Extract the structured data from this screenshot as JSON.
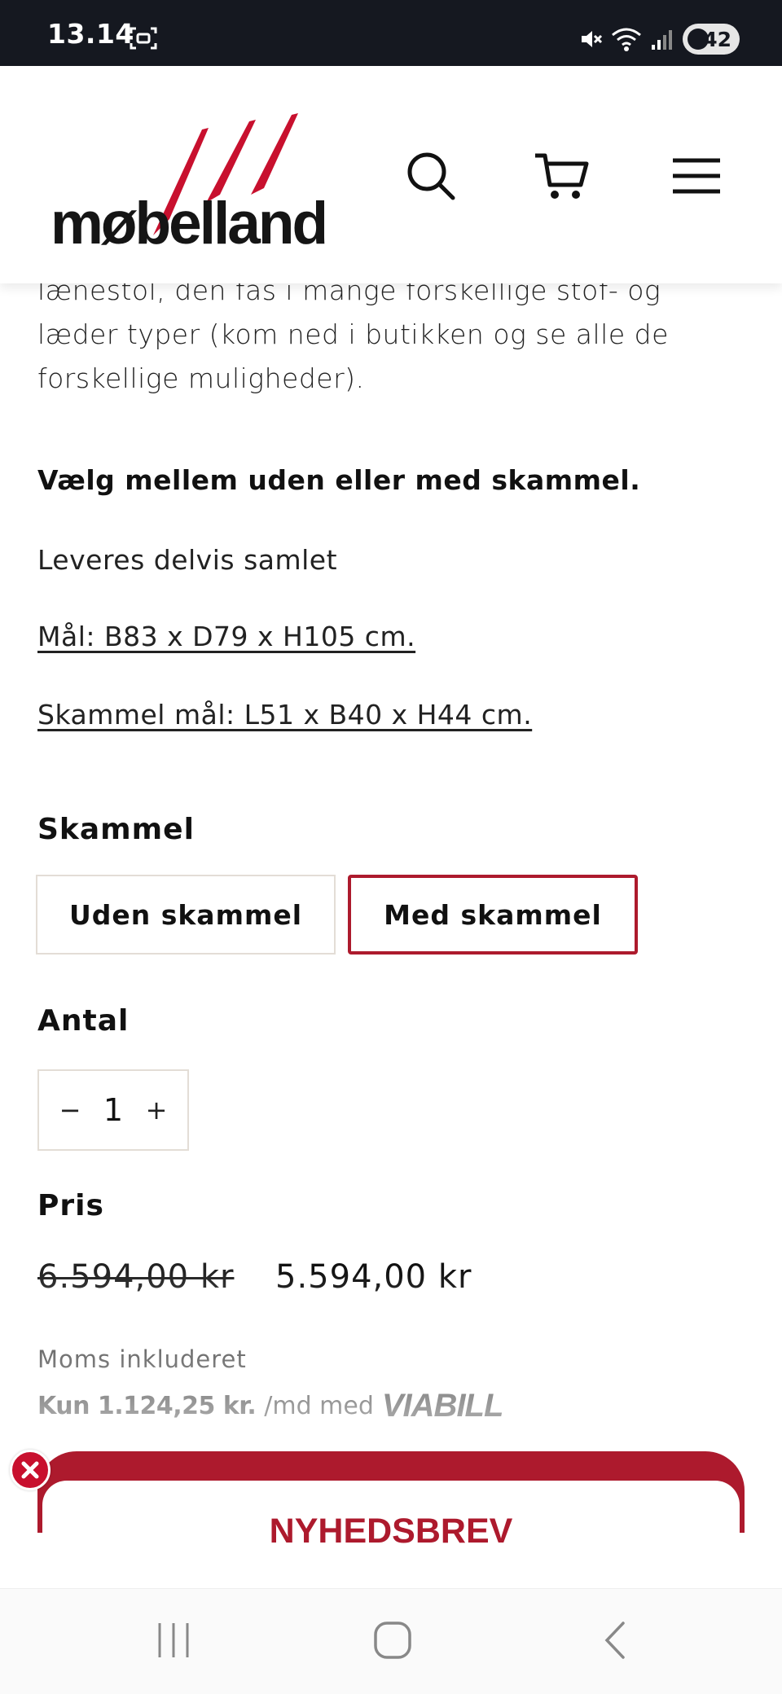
{
  "status_bar": {
    "time": "13.14",
    "battery": "42"
  },
  "header": {
    "logo_text": "møbelland",
    "icons": [
      "search-icon",
      "cart-icon",
      "menu-icon"
    ]
  },
  "description": {
    "lines": [
      "lænestol, den fås i mange forskellige stof- og",
      "læder typer (kom ned i butikken og se alle de",
      "forskellige muligheder)."
    ],
    "bold_line": "Vælg mellem uden eller med skammel.",
    "assembly": "Leveres delvis samlet",
    "measure_chair": "Mål: B83 x D79 x H105 cm. ",
    "measure_stool": "Skammel mål: L51 x B40 x H44 cm. "
  },
  "variant": {
    "label": "Skammel",
    "options": [
      "Uden skammel",
      "Med skammel"
    ],
    "selected": "Med skammel"
  },
  "quantity": {
    "label": "Antal",
    "minus": "−",
    "value": "1",
    "plus": "+"
  },
  "price": {
    "label": "Pris",
    "old": "6.594,00 kr",
    "new": "5.594,00 kr",
    "tax_note": "Moms inkluderet",
    "installment_bold": "Kun 1.124,25 kr.",
    "installment_rest": "/md med",
    "installment_provider": "VIABILL"
  },
  "newsletter": {
    "title": "NYHEDSBREV"
  },
  "colors": {
    "brand_red": "#ad1a2d",
    "close_red": "#c8102e",
    "status_bg": "#151820"
  }
}
